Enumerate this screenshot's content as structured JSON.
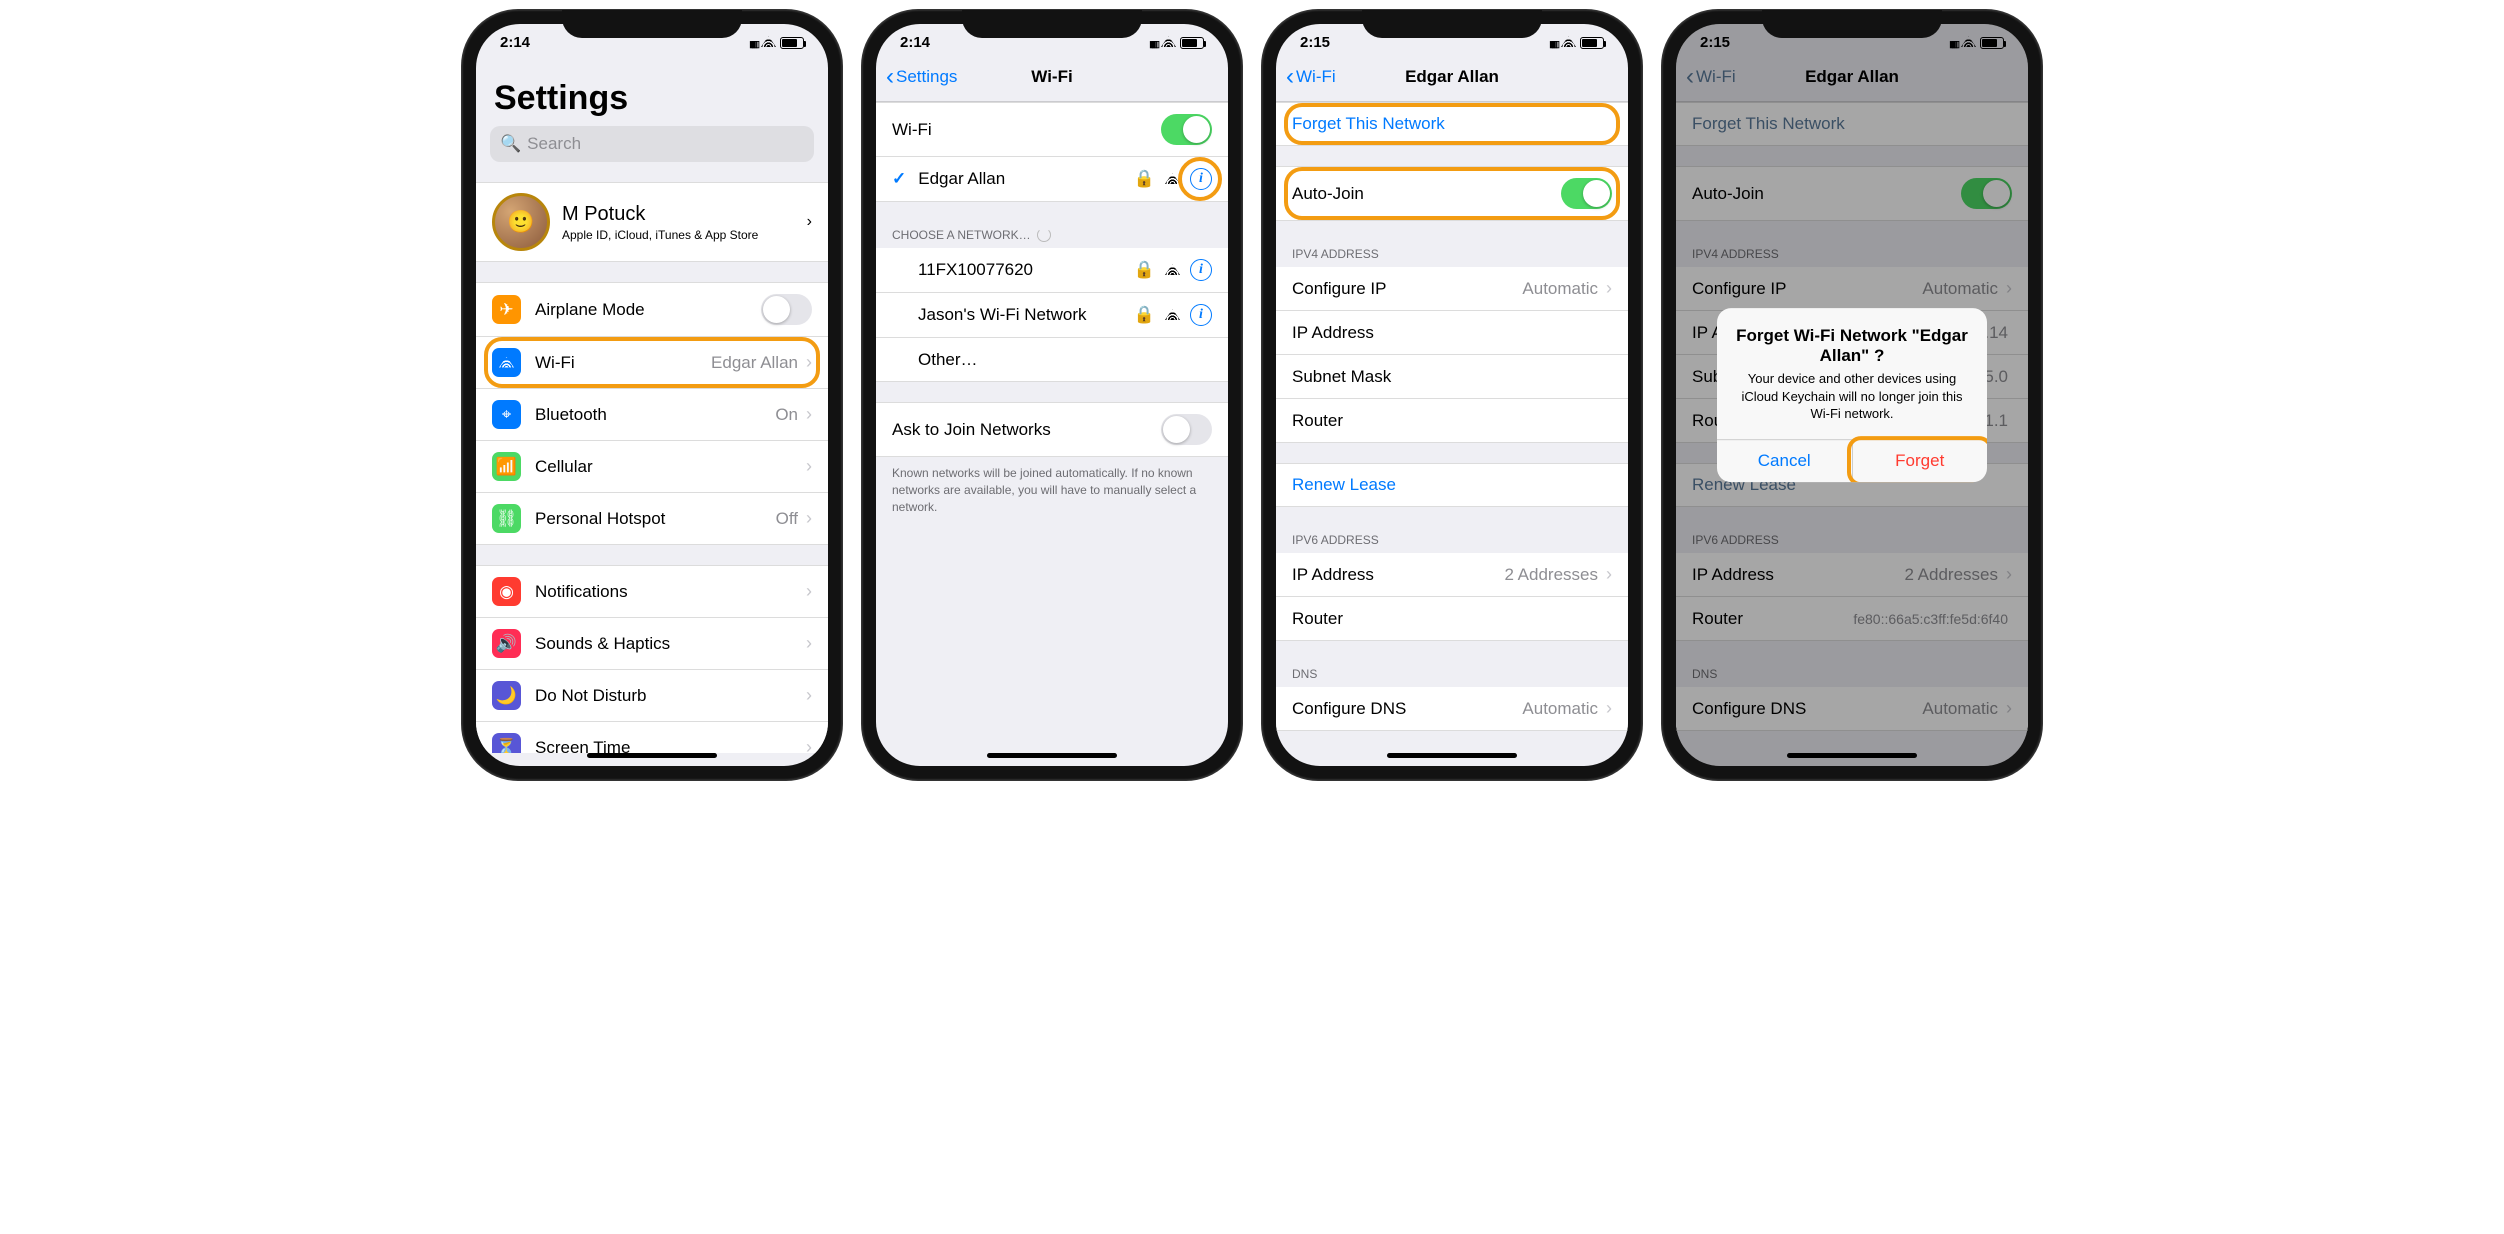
{
  "status": {
    "time1": "2:14",
    "time2": "2:14",
    "time3": "2:15",
    "time4": "2:15",
    "loc": "↗"
  },
  "s1": {
    "title": "Settings",
    "search": "Search",
    "profile": {
      "name": "M Potuck",
      "sub": "Apple ID, iCloud, iTunes & App Store"
    },
    "rows": {
      "airplane": "Airplane Mode",
      "wifi": "Wi-Fi",
      "wifi_val": "Edgar Allan",
      "bt": "Bluetooth",
      "bt_val": "On",
      "cell": "Cellular",
      "hotspot": "Personal Hotspot",
      "hotspot_val": "Off",
      "notif": "Notifications",
      "sounds": "Sounds & Haptics",
      "dnd": "Do Not Disturb",
      "st": "Screen Time"
    }
  },
  "s2": {
    "back": "Settings",
    "title": "Wi-Fi",
    "wifi_label": "Wi-Fi",
    "connected": "Edgar Allan",
    "choose": "CHOOSE A NETWORK…",
    "net1": "11FX10077620",
    "net2": "Jason's Wi-Fi Network",
    "other": "Other…",
    "ask": "Ask to Join Networks",
    "footer": "Known networks will be joined automatically. If no known networks are available, you will have to manually select a network."
  },
  "s3": {
    "back": "Wi-Fi",
    "title": "Edgar Allan",
    "forget": "Forget This Network",
    "autojoin": "Auto-Join",
    "ipv4": "IPV4 ADDRESS",
    "configip": "Configure IP",
    "configip_val": "Automatic",
    "ip": "IP Address",
    "subnet": "Subnet Mask",
    "router": "Router",
    "renew": "Renew Lease",
    "ipv6": "IPV6 ADDRESS",
    "ip6": "IP Address",
    "ip6_val": "2 Addresses",
    "router6": "Router",
    "dns": "DNS",
    "configdns": "Configure DNS",
    "configdns_val": "Automatic"
  },
  "s4": {
    "back": "Wi-Fi",
    "title": "Edgar Allan",
    "forget": "Forget This Network",
    "autojoin": "Auto-Join",
    "ipv4": "IPV4 ADDRESS",
    "configip": "Configure IP",
    "configip_val": "Automatic",
    "ip": "IP Address",
    "ip_val": "0.1.14",
    "subnet": "Subnet Mask",
    "subnet_val": "255.0",
    "router": "Router",
    "router_val": "0.1.1",
    "renew": "Renew Lease",
    "ipv6": "IPV6 ADDRESS",
    "ip6": "IP Address",
    "ip6_val": "2 Addresses",
    "router6": "Router",
    "router6_val": "fe80::66a5:c3ff:fe5d:6f40",
    "dns": "DNS",
    "configdns": "Configure DNS",
    "configdns_val": "Automatic",
    "alert": {
      "title": "Forget Wi-Fi Network \"Edgar Allan\" ?",
      "msg": "Your device and other devices using iCloud Keychain will no longer join this Wi-Fi network.",
      "cancel": "Cancel",
      "forget": "Forget"
    }
  }
}
